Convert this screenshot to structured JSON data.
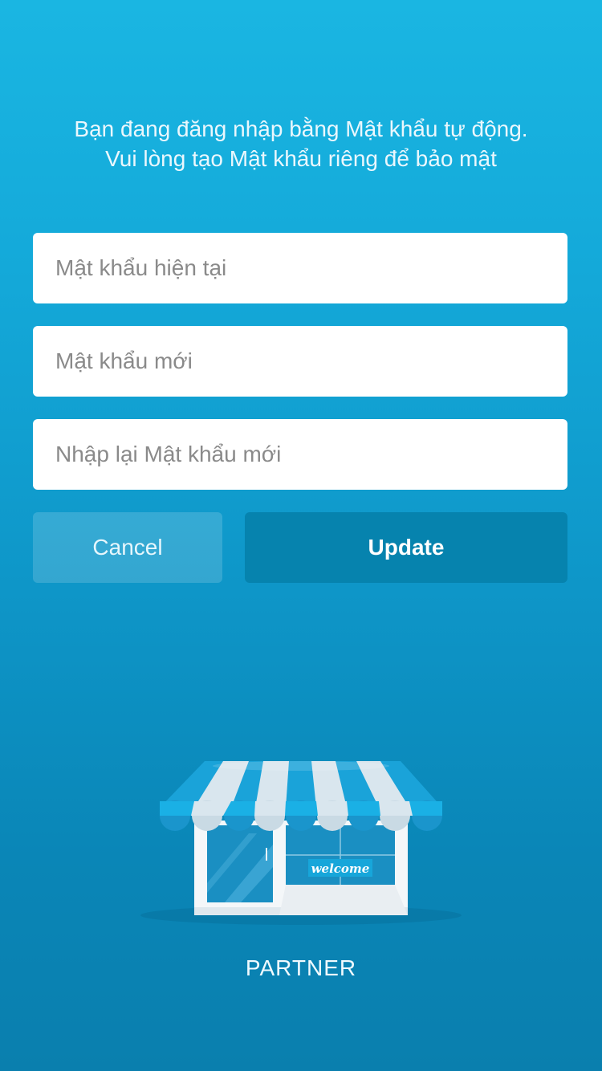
{
  "intro": {
    "line1": "Bạn đang đăng nhập bằng Mật khẩu tự động.",
    "line2": "Vui lòng tạo Mật khẩu riêng để bảo mật"
  },
  "form": {
    "current_password": {
      "placeholder": "Mật khẩu hiện tại",
      "value": ""
    },
    "new_password": {
      "placeholder": "Mật khẩu mới",
      "value": ""
    },
    "confirm_password": {
      "placeholder": "Nhập lại Mật khẩu mới",
      "value": ""
    }
  },
  "actions": {
    "cancel_label": "Cancel",
    "update_label": "Update"
  },
  "illustration": {
    "sign_text": "welcome",
    "icon": "store-icon"
  },
  "footer": {
    "label": "PARTNER"
  },
  "colors": {
    "background_top": "#1ab6e2",
    "background_bottom": "#0a7fae",
    "update_button": "#0683ae",
    "cancel_button": "rgba(255,255,255,0.16)"
  }
}
